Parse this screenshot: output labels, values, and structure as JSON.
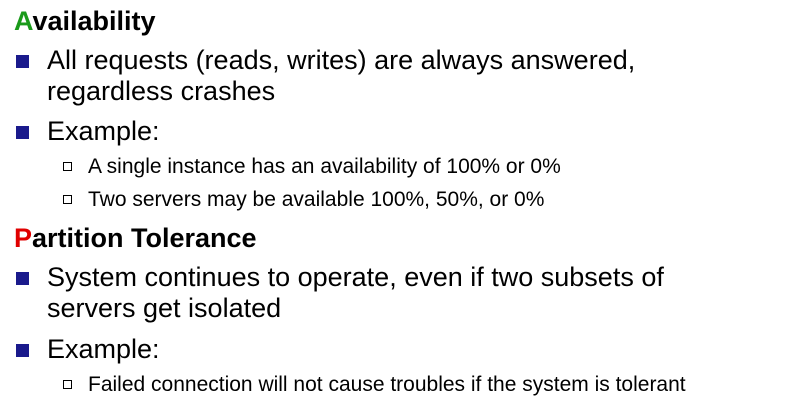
{
  "colors": {
    "availability_initial": "#1a9a1a",
    "partition_initial": "#e00000",
    "bullet": "#1a1a8c",
    "text": "#000000"
  },
  "sections": [
    {
      "heading_initial": "A",
      "heading_rest": "vailability",
      "bullets": [
        {
          "lines": [
            "All requests (reads, writes) are always answered,",
            "regardless crashes"
          ],
          "sub": []
        },
        {
          "lines": [
            "Example:"
          ],
          "sub": [
            "A single instance has an availability of 100% or 0%",
            "Two servers may be available 100%, 50%, or 0%"
          ]
        }
      ]
    },
    {
      "heading_initial": "P",
      "heading_rest": "artition Tolerance",
      "bullets": [
        {
          "lines": [
            "System continues to operate, even if two subsets of",
            "servers get isolated"
          ],
          "sub": []
        },
        {
          "lines": [
            "Example:"
          ],
          "sub": [
            "Failed connection will not cause troubles if the system is tolerant"
          ]
        }
      ]
    }
  ],
  "icons": {
    "level1_bullet": "filled-square-bullet-icon",
    "level2_bullet": "hollow-square-bullet-icon"
  }
}
